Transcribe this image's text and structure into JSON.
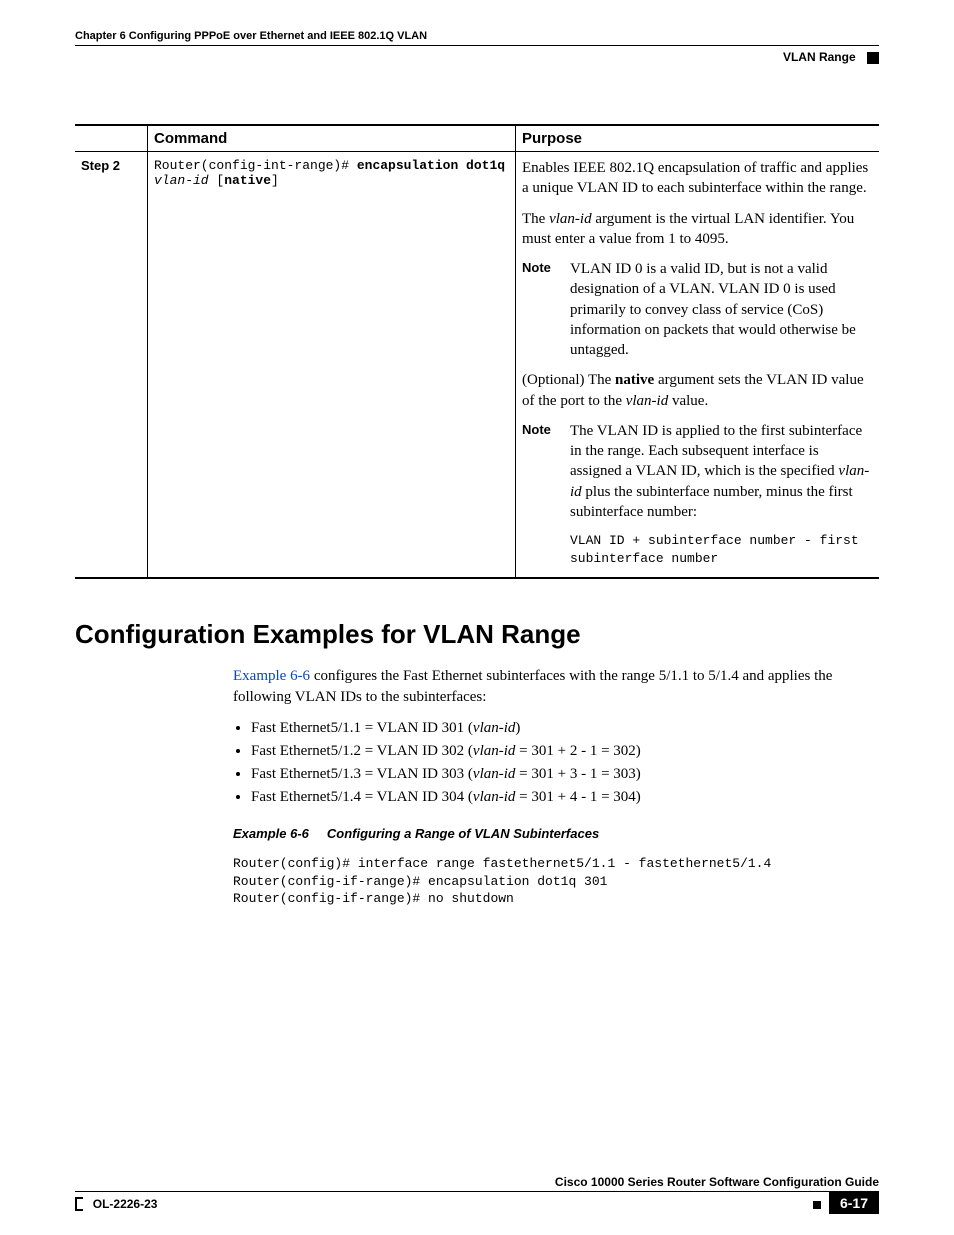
{
  "header": {
    "chapter": "Chapter 6    Configuring PPPoE over Ethernet and IEEE 802.1Q VLAN",
    "section_label": "VLAN Range"
  },
  "table": {
    "head": {
      "col1": "Command",
      "col2": "Purpose"
    },
    "step": "Step 2",
    "cmd_prompt": "Router(config-int-range)# ",
    "cmd_kw1": "encapsulation dot1q",
    "cmd_arg": "vlan-id",
    "cmd_kw2": "native",
    "purpose": {
      "p1": "Enables IEEE 802.1Q encapsulation of traffic and applies a unique VLAN ID to each subinterface within the range.",
      "p2a": "The ",
      "p2_arg": "vlan-id",
      "p2b": " argument is the virtual LAN identifier. You must enter a value from 1 to 4095.",
      "note1_label": "Note",
      "note1": "VLAN ID 0 is a valid ID, but is not a valid designation of a VLAN. VLAN ID 0 is used primarily to convey class of service (CoS) information on packets that would otherwise be untagged.",
      "p3a": "(Optional) The ",
      "p3_kw": "native",
      "p3b": " argument sets the VLAN ID value of the port to the ",
      "p3_arg": "vlan-id",
      "p3c": " value.",
      "note2_label": "Note",
      "note2a": "The VLAN ID is applied to the first subinterface in the range. Each subsequent interface is assigned a VLAN ID, which is the specified ",
      "note2_arg": "vlan-id",
      "note2b": " plus the subinterface number, minus the first subinterface number:",
      "formula": "VLAN ID + subinterface number - first \nsubinterface number"
    }
  },
  "section": {
    "title": "Configuration Examples for VLAN Range",
    "intro_link": "Example 6-6",
    "intro_rest": " configures the Fast Ethernet subinterfaces with the range 5/1.1 to 5/1.4 and applies the following VLAN IDs to the subinterfaces:",
    "bullets": [
      {
        "iface": "Fast Ethernet5/1.1 = VLAN ID 301 (",
        "arg": "vlan-id",
        "tail": ")"
      },
      {
        "iface": "Fast Ethernet5/1.2 = VLAN ID 302 (",
        "arg": "vlan-id",
        "tail": " = 301 + 2 - 1 = 302)"
      },
      {
        "iface": "Fast Ethernet5/1.3 = VLAN ID 303 (",
        "arg": "vlan-id",
        "tail": " = 301 + 3 - 1 = 303)"
      },
      {
        "iface": "Fast Ethernet5/1.4 = VLAN ID 304 (",
        "arg": "vlan-id",
        "tail": " = 301 + 4 - 1 = 304)"
      }
    ],
    "example_num": "Example 6-6",
    "example_title": "Configuring a Range of VLAN Subinterfaces",
    "example_code": "Router(config)# interface range fastethernet5/1.1 - fastethernet5/1.4\nRouter(config-if-range)# encapsulation dot1q 301\nRouter(config-if-range)# no shutdown"
  },
  "footer": {
    "guide": "Cisco 10000 Series Router Software Configuration Guide",
    "docid": "OL-2226-23",
    "page": "6-17"
  }
}
